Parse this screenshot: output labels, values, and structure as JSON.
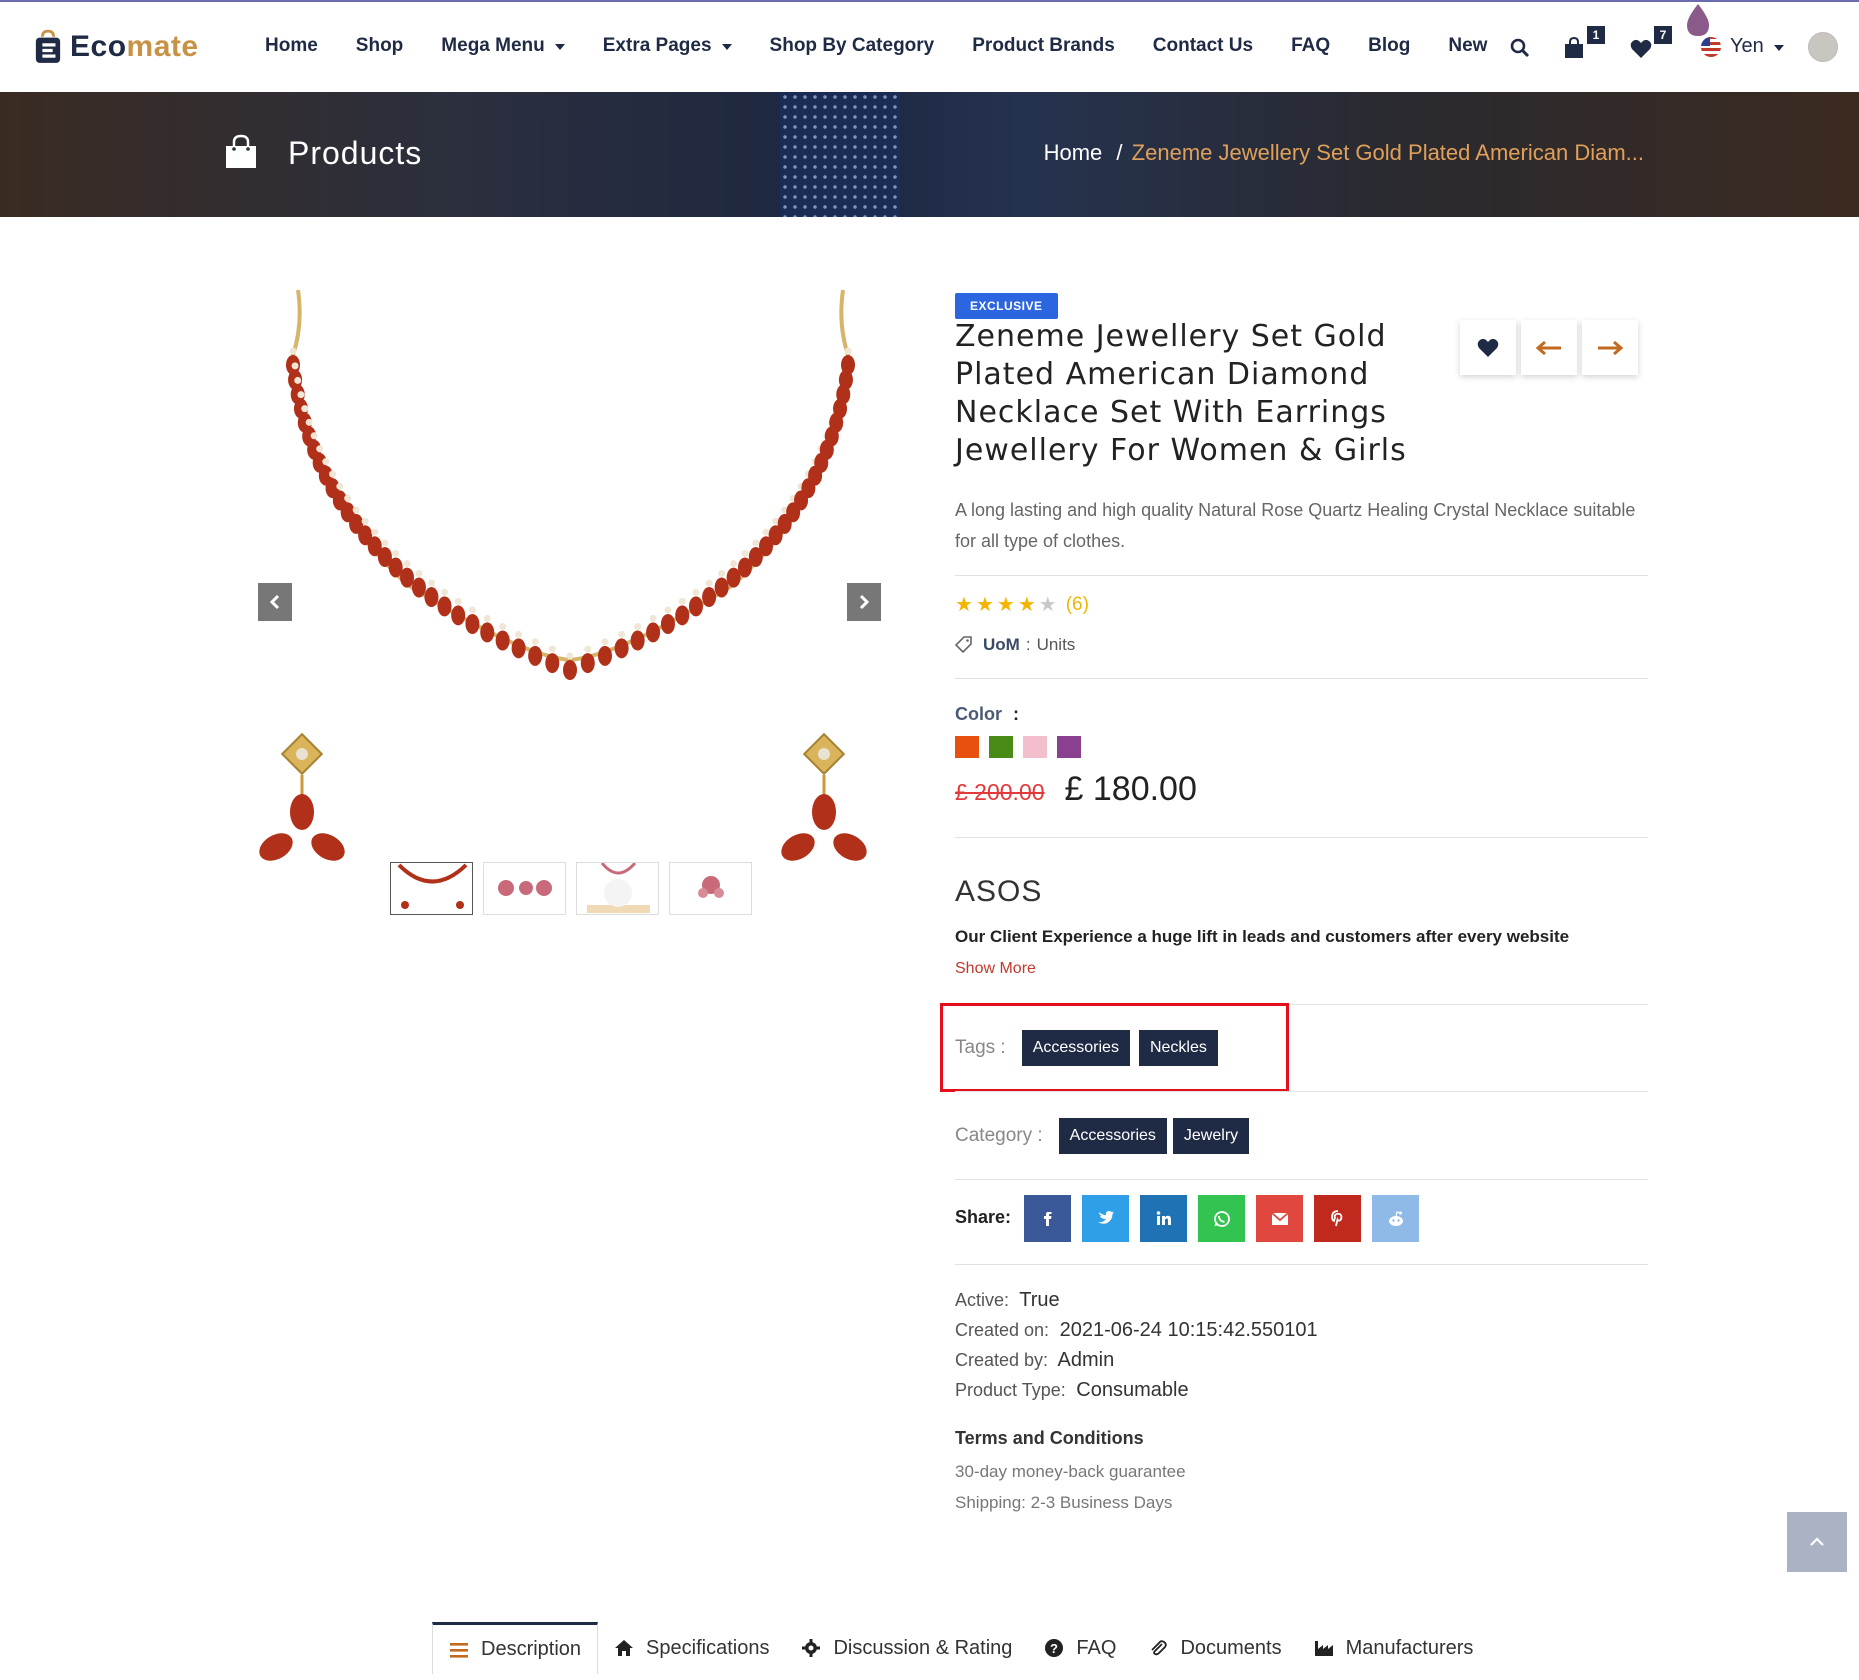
{
  "brand": {
    "name_part1": "Eco",
    "name_part2": "mate"
  },
  "nav": {
    "items": [
      {
        "label": "Home",
        "dropdown": false
      },
      {
        "label": "Shop",
        "dropdown": false
      },
      {
        "label": "Mega Menu",
        "dropdown": true
      },
      {
        "label": "Extra Pages",
        "dropdown": true
      },
      {
        "label": "Shop By Category",
        "dropdown": false
      },
      {
        "label": "Product Brands",
        "dropdown": false
      },
      {
        "label": "Contact Us",
        "dropdown": false
      },
      {
        "label": "FAQ",
        "dropdown": false
      },
      {
        "label": "Blog",
        "dropdown": false
      },
      {
        "label": "New",
        "dropdown": false
      }
    ],
    "cart_count": "1",
    "wishlist_count": "7",
    "currency": "Yen"
  },
  "banner": {
    "title": "Products",
    "breadcrumb_home": "Home",
    "breadcrumb_sep": "/",
    "breadcrumb_current": "Zeneme Jewellery Set Gold Plated American Diam..."
  },
  "product": {
    "badge": "EXCLUSIVE",
    "title": "Zeneme Jewellery Set Gold Plated American Diamond Necklace Set With Earrings Jewellery For Women & Girls",
    "description": "A long lasting and high quality Natural Rose Quartz Healing Crystal Necklace suitable for all type of clothes.",
    "rating": 4,
    "rating_max": 5,
    "review_count": "(6)",
    "uom_label": "UoM",
    "uom_sep": ":",
    "uom_value": "Units",
    "color_label": "Color",
    "color_sep": ":",
    "colors": [
      "#e8500f",
      "#4a8a17",
      "#f3bfcd",
      "#8a3f8f"
    ],
    "old_price": "£ 200.00",
    "price": "£ 180.00",
    "brand_name": "ASOS",
    "brand_desc": "Our Client Experience a huge lift in leads and customers after every website",
    "show_more": "Show More",
    "tags_label": "Tags :",
    "tags": [
      "Accessories",
      "Neckles"
    ],
    "category_label": "Category :",
    "categories": [
      "Accessories",
      "Jewelry"
    ],
    "share_label": "Share:",
    "share": [
      {
        "name": "facebook",
        "glyph": "f",
        "color": "#3b5998"
      },
      {
        "name": "twitter",
        "glyph": "t",
        "color": "#2fa0e8"
      },
      {
        "name": "linkedin",
        "glyph": "in",
        "color": "#1f72b3"
      },
      {
        "name": "whatsapp",
        "glyph": "w",
        "color": "#32c351"
      },
      {
        "name": "email",
        "glyph": "@",
        "color": "#e0473e"
      },
      {
        "name": "pinterest",
        "glyph": "p",
        "color": "#c02a1e"
      },
      {
        "name": "reddit",
        "glyph": "r",
        "color": "#8fb9e6"
      }
    ],
    "meta": [
      {
        "label": "Active:",
        "value": "True"
      },
      {
        "label": "Created on:",
        "value": "2021-06-24 10:15:42.550101"
      },
      {
        "label": "Created by:",
        "value": "Admin"
      },
      {
        "label": "Product Type:",
        "value": "Consumable"
      }
    ],
    "terms_title": "Terms and Conditions",
    "terms": [
      "30-day money-back guarantee",
      "Shipping: 2-3 Business Days"
    ]
  },
  "tabs": [
    {
      "label": "Description",
      "icon": "list-icon",
      "active": true
    },
    {
      "label": "Specifications",
      "icon": "home-icon",
      "active": false
    },
    {
      "label": "Discussion & Rating",
      "icon": "gear-icon",
      "active": false
    },
    {
      "label": "FAQ",
      "icon": "question-icon",
      "active": false
    },
    {
      "label": "Documents",
      "icon": "paperclip-icon",
      "active": false
    },
    {
      "label": "Manufacturers",
      "icon": "factory-icon",
      "active": false
    }
  ]
}
